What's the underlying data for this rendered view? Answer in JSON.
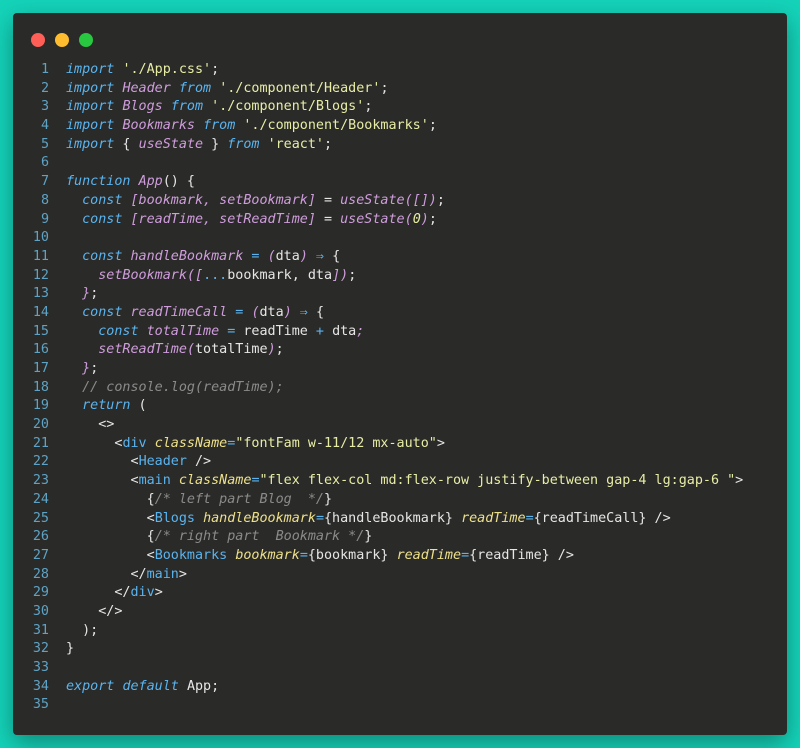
{
  "colors": {
    "background": "#14d3b9",
    "window": "#2a2a28",
    "close": "#ff5f57",
    "minimize": "#febc2e",
    "maximize": "#28c840"
  },
  "window_controls": [
    "close",
    "minimize",
    "maximize"
  ],
  "lines": [
    {
      "n": "1",
      "tokens": [
        {
          "t": "import",
          "c": "kw"
        },
        {
          "t": " ",
          "c": "pl"
        },
        {
          "t": "'./App.css'",
          "c": "str"
        },
        {
          "t": ";",
          "c": "pl"
        }
      ]
    },
    {
      "n": "2",
      "tokens": [
        {
          "t": "import",
          "c": "kw"
        },
        {
          "t": " ",
          "c": "pl"
        },
        {
          "t": "Header",
          "c": "id"
        },
        {
          "t": " ",
          "c": "pl"
        },
        {
          "t": "from",
          "c": "kw"
        },
        {
          "t": " ",
          "c": "pl"
        },
        {
          "t": "'./component/Header'",
          "c": "str"
        },
        {
          "t": ";",
          "c": "pl"
        }
      ]
    },
    {
      "n": "3",
      "tokens": [
        {
          "t": "import",
          "c": "kw"
        },
        {
          "t": " ",
          "c": "pl"
        },
        {
          "t": "Blogs",
          "c": "id"
        },
        {
          "t": " ",
          "c": "pl"
        },
        {
          "t": "from",
          "c": "kw"
        },
        {
          "t": " ",
          "c": "pl"
        },
        {
          "t": "'./component/Blogs'",
          "c": "str"
        },
        {
          "t": ";",
          "c": "pl"
        }
      ]
    },
    {
      "n": "4",
      "tokens": [
        {
          "t": "import",
          "c": "kw"
        },
        {
          "t": " ",
          "c": "pl"
        },
        {
          "t": "Bookmarks",
          "c": "id"
        },
        {
          "t": " ",
          "c": "pl"
        },
        {
          "t": "from",
          "c": "kw"
        },
        {
          "t": " ",
          "c": "pl"
        },
        {
          "t": "'./component/Bookmarks'",
          "c": "str"
        },
        {
          "t": ";",
          "c": "pl"
        }
      ]
    },
    {
      "n": "5",
      "tokens": [
        {
          "t": "import",
          "c": "kw"
        },
        {
          "t": " { ",
          "c": "pl"
        },
        {
          "t": "useState",
          "c": "id"
        },
        {
          "t": " } ",
          "c": "pl"
        },
        {
          "t": "from",
          "c": "kw"
        },
        {
          "t": " ",
          "c": "pl"
        },
        {
          "t": "'react'",
          "c": "str"
        },
        {
          "t": ";",
          "c": "pl"
        }
      ]
    },
    {
      "n": "6",
      "tokens": []
    },
    {
      "n": "7",
      "tokens": [
        {
          "t": "function",
          "c": "kw"
        },
        {
          "t": " ",
          "c": "pl"
        },
        {
          "t": "App",
          "c": "id"
        },
        {
          "t": "() {",
          "c": "pl"
        }
      ]
    },
    {
      "n": "8",
      "tokens": [
        {
          "t": "  ",
          "c": "pl"
        },
        {
          "t": "const",
          "c": "kw"
        },
        {
          "t": " ",
          "c": "pl"
        },
        {
          "t": "[bookmark, setBookmark]",
          "c": "id"
        },
        {
          "t": " = ",
          "c": "pl"
        },
        {
          "t": "useState",
          "c": "id"
        },
        {
          "t": "([])",
          "c": "id"
        },
        {
          "t": ";",
          "c": "pl"
        }
      ]
    },
    {
      "n": "9",
      "tokens": [
        {
          "t": "  ",
          "c": "pl"
        },
        {
          "t": "const",
          "c": "kw"
        },
        {
          "t": " ",
          "c": "pl"
        },
        {
          "t": "[readTime, setReadTime]",
          "c": "id"
        },
        {
          "t": " = ",
          "c": "pl"
        },
        {
          "t": "useState",
          "c": "id"
        },
        {
          "t": "(",
          "c": "id"
        },
        {
          "t": "0",
          "c": "num"
        },
        {
          "t": ")",
          "c": "id"
        },
        {
          "t": ";",
          "c": "pl"
        }
      ]
    },
    {
      "n": "10",
      "tokens": []
    },
    {
      "n": "11",
      "tokens": [
        {
          "t": "  ",
          "c": "pl"
        },
        {
          "t": "const",
          "c": "kw"
        },
        {
          "t": " ",
          "c": "pl"
        },
        {
          "t": "handleBookmark",
          "c": "id"
        },
        {
          "t": " = ",
          "c": "op"
        },
        {
          "t": "(",
          "c": "id"
        },
        {
          "t": "dta",
          "c": "pl"
        },
        {
          "t": ")",
          "c": "id"
        },
        {
          "t": " ⇒ ",
          "c": "op"
        },
        {
          "t": "{",
          "c": "pl"
        }
      ]
    },
    {
      "n": "12",
      "tokens": [
        {
          "t": "    ",
          "c": "pl"
        },
        {
          "t": "setBookmark",
          "c": "id"
        },
        {
          "t": "([",
          "c": "id"
        },
        {
          "t": "...",
          "c": "op"
        },
        {
          "t": "bookmark, dta",
          "c": "pl"
        },
        {
          "t": "])",
          "c": "id"
        },
        {
          "t": ";",
          "c": "pl"
        }
      ]
    },
    {
      "n": "13",
      "tokens": [
        {
          "t": "  ",
          "c": "pl"
        },
        {
          "t": "}",
          "c": "id"
        },
        {
          "t": ";",
          "c": "pl"
        }
      ]
    },
    {
      "n": "14",
      "tokens": [
        {
          "t": "  ",
          "c": "pl"
        },
        {
          "t": "const",
          "c": "kw"
        },
        {
          "t": " ",
          "c": "pl"
        },
        {
          "t": "readTimeCall",
          "c": "id"
        },
        {
          "t": " = ",
          "c": "op"
        },
        {
          "t": "(",
          "c": "id"
        },
        {
          "t": "dta",
          "c": "pl"
        },
        {
          "t": ")",
          "c": "id"
        },
        {
          "t": " ⇒ ",
          "c": "op"
        },
        {
          "t": "{",
          "c": "pl"
        }
      ]
    },
    {
      "n": "15",
      "tokens": [
        {
          "t": "    ",
          "c": "pl"
        },
        {
          "t": "const",
          "c": "kw"
        },
        {
          "t": " ",
          "c": "pl"
        },
        {
          "t": "totalTime",
          "c": "id"
        },
        {
          "t": " = ",
          "c": "op"
        },
        {
          "t": "readTime",
          "c": "pl"
        },
        {
          "t": " + ",
          "c": "op"
        },
        {
          "t": "dta",
          "c": "pl"
        },
        {
          "t": ";",
          "c": "id"
        }
      ]
    },
    {
      "n": "16",
      "tokens": [
        {
          "t": "    ",
          "c": "pl"
        },
        {
          "t": "setReadTime",
          "c": "id"
        },
        {
          "t": "(",
          "c": "id"
        },
        {
          "t": "totalTime",
          "c": "pl"
        },
        {
          "t": ")",
          "c": "id"
        },
        {
          "t": ";",
          "c": "pl"
        }
      ]
    },
    {
      "n": "17",
      "tokens": [
        {
          "t": "  ",
          "c": "pl"
        },
        {
          "t": "}",
          "c": "id"
        },
        {
          "t": ";",
          "c": "pl"
        }
      ]
    },
    {
      "n": "18",
      "tokens": [
        {
          "t": "  ",
          "c": "pl"
        },
        {
          "t": "// console.log(readTime);",
          "c": "cm"
        }
      ]
    },
    {
      "n": "19",
      "tokens": [
        {
          "t": "  ",
          "c": "pl"
        },
        {
          "t": "return",
          "c": "kw"
        },
        {
          "t": " (",
          "c": "pl"
        }
      ]
    },
    {
      "n": "20",
      "tokens": [
        {
          "t": "    ",
          "c": "pl"
        },
        {
          "t": "<>",
          "c": "br"
        }
      ]
    },
    {
      "n": "21",
      "tokens": [
        {
          "t": "      ",
          "c": "pl"
        },
        {
          "t": "<",
          "c": "br"
        },
        {
          "t": "div",
          "c": "tag"
        },
        {
          "t": " ",
          "c": "pl"
        },
        {
          "t": "className",
          "c": "attr"
        },
        {
          "t": "=",
          "c": "op"
        },
        {
          "t": "\"fontFam w-11/12 mx-auto\"",
          "c": "str"
        },
        {
          "t": ">",
          "c": "br"
        }
      ]
    },
    {
      "n": "22",
      "tokens": [
        {
          "t": "        ",
          "c": "pl"
        },
        {
          "t": "<",
          "c": "br"
        },
        {
          "t": "Header",
          "c": "tag"
        },
        {
          "t": " />",
          "c": "br"
        }
      ]
    },
    {
      "n": "23",
      "tokens": [
        {
          "t": "        ",
          "c": "pl"
        },
        {
          "t": "<",
          "c": "br"
        },
        {
          "t": "main",
          "c": "tag"
        },
        {
          "t": " ",
          "c": "pl"
        },
        {
          "t": "className",
          "c": "attr"
        },
        {
          "t": "=",
          "c": "op"
        },
        {
          "t": "\"flex flex-col md:flex-row justify-between gap-4 lg:gap-6 \"",
          "c": "str"
        },
        {
          "t": ">",
          "c": "br"
        }
      ]
    },
    {
      "n": "24",
      "tokens": [
        {
          "t": "          ",
          "c": "pl"
        },
        {
          "t": "{",
          "c": "br"
        },
        {
          "t": "/* left part Blog  */",
          "c": "cm"
        },
        {
          "t": "}",
          "c": "br"
        }
      ]
    },
    {
      "n": "25",
      "tokens": [
        {
          "t": "          ",
          "c": "pl"
        },
        {
          "t": "<",
          "c": "br"
        },
        {
          "t": "Blogs",
          "c": "tag"
        },
        {
          "t": " ",
          "c": "pl"
        },
        {
          "t": "handleBookmark",
          "c": "attr"
        },
        {
          "t": "=",
          "c": "op"
        },
        {
          "t": "{handleBookmark}",
          "c": "pl"
        },
        {
          "t": " ",
          "c": "pl"
        },
        {
          "t": "readTime",
          "c": "attr"
        },
        {
          "t": "=",
          "c": "op"
        },
        {
          "t": "{readTimeCall}",
          "c": "pl"
        },
        {
          "t": " />",
          "c": "br"
        }
      ]
    },
    {
      "n": "26",
      "tokens": [
        {
          "t": "          ",
          "c": "pl"
        },
        {
          "t": "{",
          "c": "br"
        },
        {
          "t": "/* right part  Bookmark */",
          "c": "cm"
        },
        {
          "t": "}",
          "c": "br"
        }
      ]
    },
    {
      "n": "27",
      "tokens": [
        {
          "t": "          ",
          "c": "pl"
        },
        {
          "t": "<",
          "c": "br"
        },
        {
          "t": "Bookmarks",
          "c": "tag"
        },
        {
          "t": " ",
          "c": "pl"
        },
        {
          "t": "bookmark",
          "c": "attr"
        },
        {
          "t": "=",
          "c": "op"
        },
        {
          "t": "{bookmark}",
          "c": "pl"
        },
        {
          "t": " ",
          "c": "pl"
        },
        {
          "t": "readTime",
          "c": "attr"
        },
        {
          "t": "=",
          "c": "op"
        },
        {
          "t": "{readTime}",
          "c": "pl"
        },
        {
          "t": " />",
          "c": "br"
        }
      ]
    },
    {
      "n": "28",
      "tokens": [
        {
          "t": "        ",
          "c": "pl"
        },
        {
          "t": "</",
          "c": "br"
        },
        {
          "t": "main",
          "c": "tag"
        },
        {
          "t": ">",
          "c": "br"
        }
      ]
    },
    {
      "n": "29",
      "tokens": [
        {
          "t": "      ",
          "c": "pl"
        },
        {
          "t": "</",
          "c": "br"
        },
        {
          "t": "div",
          "c": "tag"
        },
        {
          "t": ">",
          "c": "br"
        }
      ]
    },
    {
      "n": "30",
      "tokens": [
        {
          "t": "    ",
          "c": "pl"
        },
        {
          "t": "</>",
          "c": "br"
        }
      ]
    },
    {
      "n": "31",
      "tokens": [
        {
          "t": "  );",
          "c": "pl"
        }
      ]
    },
    {
      "n": "32",
      "tokens": [
        {
          "t": "}",
          "c": "pl"
        }
      ]
    },
    {
      "n": "33",
      "tokens": []
    },
    {
      "n": "34",
      "tokens": [
        {
          "t": "export",
          "c": "kw"
        },
        {
          "t": " ",
          "c": "pl"
        },
        {
          "t": "default",
          "c": "kw"
        },
        {
          "t": " ",
          "c": "pl"
        },
        {
          "t": "App",
          "c": "pl"
        },
        {
          "t": ";",
          "c": "pl"
        }
      ]
    },
    {
      "n": "35",
      "tokens": []
    }
  ]
}
